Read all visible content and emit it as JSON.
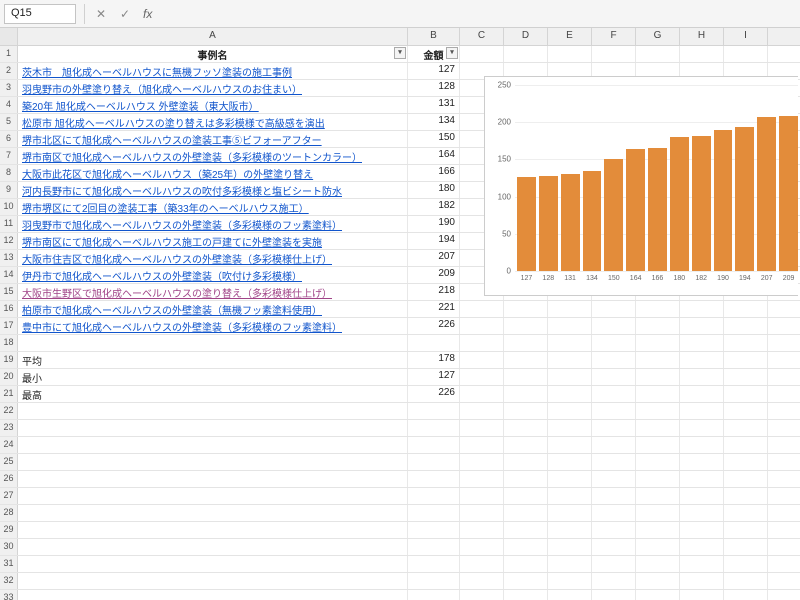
{
  "namebox": "Q15",
  "fx_cancel": "✕",
  "fx_enter": "✓",
  "fx_label": "fx",
  "colA": "A",
  "colB": "B",
  "cols_rest": [
    "C",
    "D",
    "E",
    "F",
    "G",
    "H",
    "I"
  ],
  "header": {
    "A": "事例名",
    "B": "金額"
  },
  "table_rows": [
    {
      "num": 2,
      "a": "茨木市　旭化成ヘーベルハウスに無機フッソ塗装の施工事例",
      "b": 127
    },
    {
      "num": 3,
      "a": "羽曳野市の外壁塗り替え（旭化成ヘーベルハウスのお住まい）",
      "b": 128
    },
    {
      "num": 4,
      "a": "築20年 旭化成ヘーベルハウス 外壁塗装（東大阪市）",
      "b": 131
    },
    {
      "num": 5,
      "a": "松原市 旭化成ヘーベルハウスの塗り替えは多彩模様で高級感を演出",
      "b": 134
    },
    {
      "num": 6,
      "a": "堺市北区にて旭化成ヘーベルハウスの塗装工事⑤ビフォーアフター",
      "b": 150
    },
    {
      "num": 7,
      "a": "堺市南区で旭化成ヘーベルハウスの外壁塗装（多彩模様のツートンカラー）",
      "b": 164
    },
    {
      "num": 8,
      "a": "大阪市此花区で旭化成ヘーベルハウス（築25年）の外壁塗り替え",
      "b": 166
    },
    {
      "num": 9,
      "a": "河内長野市にて旭化成ヘーベルハウスの吹付多彩模様と塩ビシート防水",
      "b": 180
    },
    {
      "num": 10,
      "a": "堺市堺区にて2回目の塗装工事（築33年のヘーベルハウス施工）",
      "b": 182
    },
    {
      "num": 11,
      "a": "羽曳野市で旭化成ヘーベルハウスの外壁塗装（多彩模様のフッ素塗料）",
      "b": 190
    },
    {
      "num": 12,
      "a": "堺市南区にて旭化成ヘーベルハウス施工の戸建てに外壁塗装を実施",
      "b": 194
    },
    {
      "num": 13,
      "a": "大阪市住吉区で旭化成ヘーベルハウスの外壁塗装（多彩模様仕上げ）",
      "b": 207
    },
    {
      "num": 14,
      "a": "伊丹市で旭化成ヘーベルハウスの外壁塗装（吹付け多彩模様）",
      "b": 209
    },
    {
      "num": 15,
      "a": "大阪市生野区で旭化成ヘーベルハウスの塗り替え（多彩模様仕上げ）",
      "b": 218,
      "visited": true
    },
    {
      "num": 16,
      "a": "柏原市で旭化成ヘーベルハウスの外壁塗装（無機フッ素塗料使用）",
      "b": 221
    },
    {
      "num": 17,
      "a": "豊中市にて旭化成ヘーベルハウスの外壁塗装（多彩模様のフッ素塗料）",
      "b": 226
    }
  ],
  "stats": [
    {
      "num": 19,
      "label": "平均",
      "val": 178
    },
    {
      "num": 20,
      "label": "最小",
      "val": 127
    },
    {
      "num": 21,
      "label": "最高",
      "val": 226
    }
  ],
  "blank_start": 22,
  "blank_end": 33,
  "chart_data": {
    "type": "bar",
    "title": "",
    "xlabel": "",
    "ylabel": "",
    "ylim": [
      0,
      250
    ],
    "yticks": [
      0,
      50,
      100,
      150,
      200,
      250
    ],
    "categories": [
      127,
      128,
      131,
      134,
      150,
      164,
      166,
      180,
      182,
      190,
      194,
      207,
      209
    ],
    "values": [
      127,
      128,
      131,
      134,
      150,
      164,
      166,
      180,
      182,
      190,
      194,
      207,
      209
    ],
    "color": "#e38c3a"
  }
}
